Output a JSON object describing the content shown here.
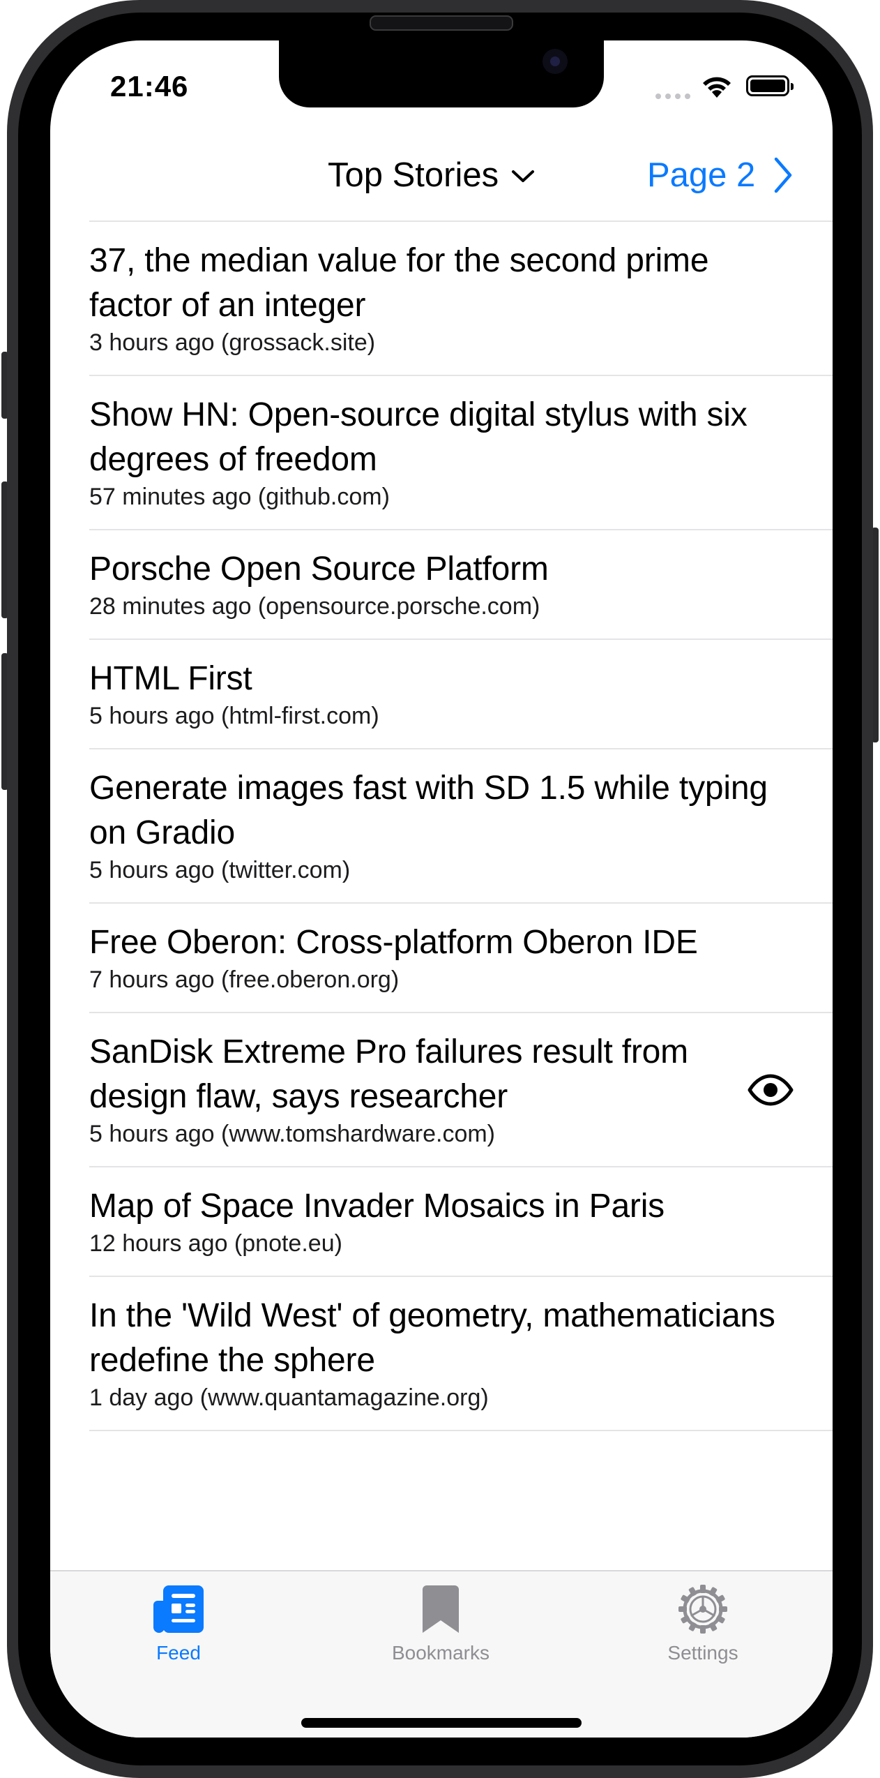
{
  "status_bar": {
    "time": "21:46"
  },
  "nav": {
    "title": "Top Stories",
    "page_label": "Page 2"
  },
  "stories": [
    {
      "title": "37, the median value for the second prime factor of an integer",
      "meta": "3 hours ago (grossack.site)"
    },
    {
      "title": "Show HN: Open-source digital stylus with six degrees of freedom",
      "meta": "57 minutes ago (github.com)"
    },
    {
      "title": "Porsche Open Source Platform",
      "meta": "28 minutes ago (opensource.porsche.com)"
    },
    {
      "title": "HTML First",
      "meta": "5 hours ago (html-first.com)"
    },
    {
      "title": "Generate images fast with SD 1.5 while typing on Gradio",
      "meta": "5 hours ago (twitter.com)"
    },
    {
      "title": "Free Oberon: Cross-platform Oberon IDE",
      "meta": "7 hours ago (free.oberon.org)"
    },
    {
      "title": "SanDisk Extreme Pro failures result from design flaw, says researcher",
      "meta": "5 hours ago (www.tomshardware.com)",
      "icon": "eye-icon"
    },
    {
      "title": "Map of Space Invader Mosaics in Paris",
      "meta": "12 hours ago (pnote.eu)"
    },
    {
      "title": "In the 'Wild West' of geometry, mathematicians redefine the sphere",
      "meta": "1 day ago (www.quantamagazine.org)"
    }
  ],
  "tabs": [
    {
      "label": "Feed",
      "icon": "newspaper-icon",
      "active": true
    },
    {
      "label": "Bookmarks",
      "icon": "bookmark-icon",
      "active": false
    },
    {
      "label": "Settings",
      "icon": "gear-icon",
      "active": false
    }
  ],
  "colors": {
    "accent": "#0a7aff",
    "inactive": "#8e8e93",
    "separator": "#e4e4e6"
  }
}
